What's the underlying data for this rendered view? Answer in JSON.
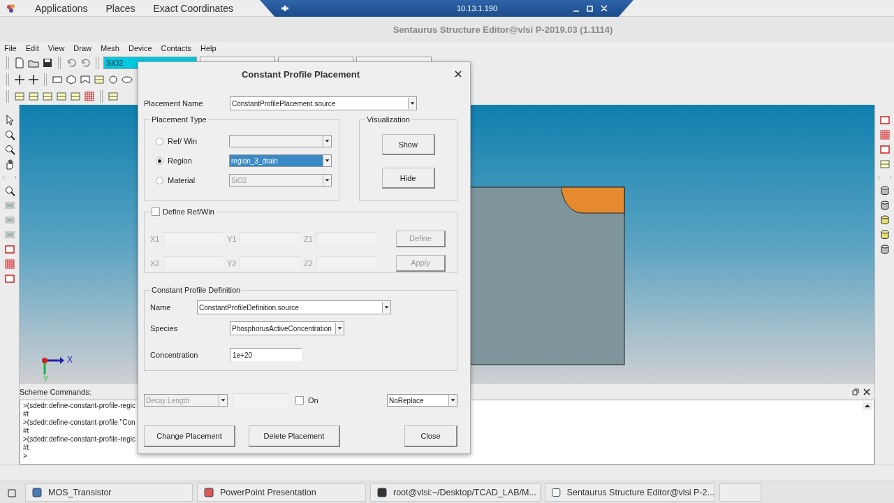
{
  "top_panel": {
    "menus": [
      "Applications",
      "Places",
      "Exact Coordinates"
    ],
    "remote_host": "10.13.1.190"
  },
  "window": {
    "title": "Sentaurus Structure Editor@vlsi P-2019.03 (1.1114)"
  },
  "menu_bar": [
    "File",
    "Edit",
    "View",
    "Draw",
    "Mesh",
    "Device",
    "Contacts",
    "Help"
  ],
  "toolbar": {
    "material": "SiO2"
  },
  "canvas": {
    "axis_x": "X",
    "axis_y": "Y"
  },
  "console": {
    "title": "Scheme Commands:",
    "lines": [
      ">(sdedr:define-constant-profile-regic",
      "#t",
      ">(sdedr:define-constant-profile \"Con",
      "#t",
      ">(sdedr:define-constant-profile-regic",
      "#t",
      ">"
    ]
  },
  "dialog": {
    "title": "Constant Profile Placement",
    "placement_name": {
      "label": "Placement Name",
      "value": "ConstantProfilePlacement.source"
    },
    "placement_type": {
      "title": "Placement Type",
      "options": [
        {
          "label": "Ref/ Win",
          "selected": false,
          "disabled": true
        },
        {
          "label": "Region",
          "selected": true,
          "disabled": false,
          "value": "region_3_drain"
        },
        {
          "label": "Material",
          "selected": false,
          "disabled": true,
          "value": "SiO2"
        }
      ]
    },
    "visualization": {
      "title": "Visualization",
      "buttons": [
        "Show",
        "Hide"
      ]
    },
    "define_refwin": {
      "label": "Define Ref/Win",
      "checked": false,
      "rows": [
        [
          "X1",
          "Y1",
          "Z1"
        ],
        [
          "X2",
          "Y2",
          "Z2"
        ]
      ],
      "buttons": [
        "Define",
        "Apply"
      ]
    },
    "definition": {
      "title": "Constant Profile Definition",
      "name_label": "Name",
      "name": "ConstantProfileDefinition.source",
      "species_label": "Species",
      "species": "PhosphorusActiveConcentration",
      "concentration_label": "Concentration",
      "concentration": "1e+20"
    },
    "decay": {
      "mode": "Decay Length",
      "disabled": true,
      "on_label": "On",
      "on": false,
      "replace": "NoReplace"
    },
    "buttons": [
      "Change Placement",
      "Delete Placement",
      "Close"
    ]
  },
  "taskbar": [
    "MOS_Transistor",
    "PowerPoint Presentation",
    "root@vlsi:~/Desktop/TCAD_LAB/M...",
    "Sentaurus Structure Editor@vlsi P-2..."
  ]
}
